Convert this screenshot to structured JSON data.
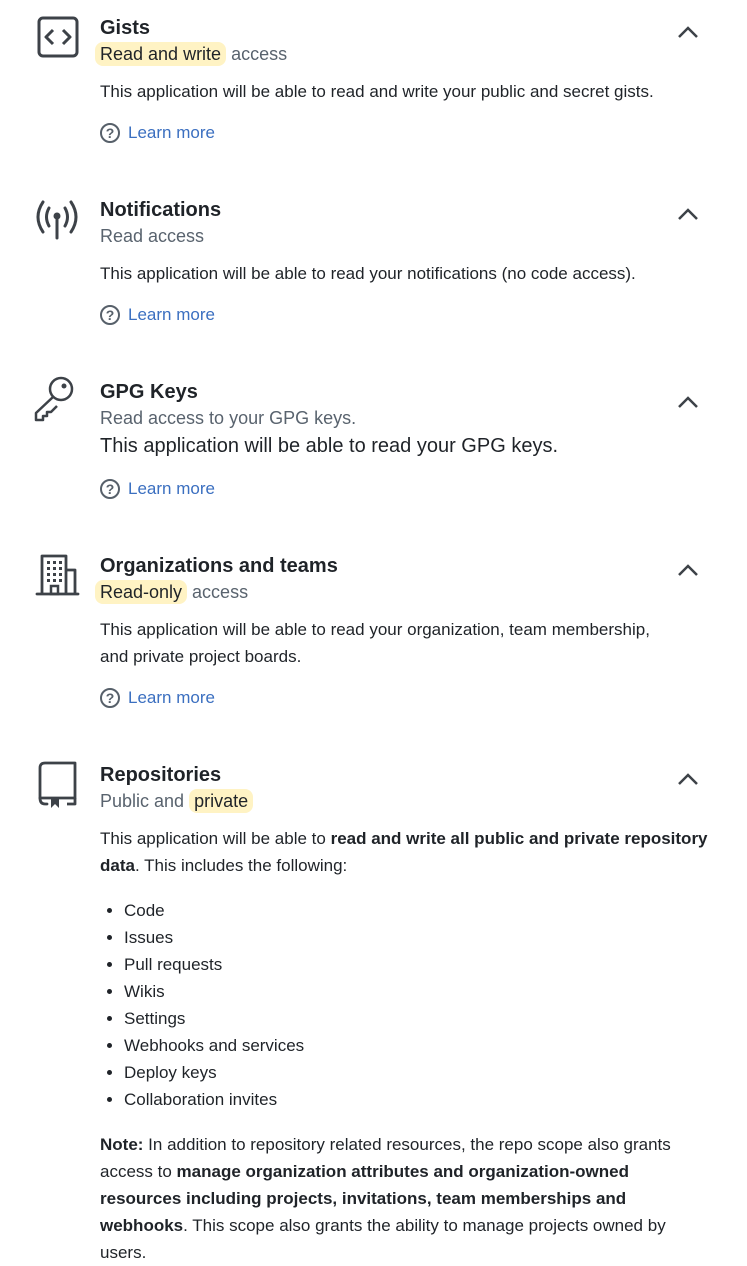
{
  "sections": {
    "gists": {
      "title": "Gists",
      "access_highlight": "Read and write",
      "access_rest": " access",
      "description": "This application will be able to read and write your public and secret gists.",
      "learn_more": "Learn more"
    },
    "notifications": {
      "title": "Notifications",
      "access": "Read access",
      "description": "This application will be able to read your notifications (no code access).",
      "learn_more": "Learn more"
    },
    "gpg": {
      "title": "GPG Keys",
      "access": "Read access to your GPG keys.",
      "description": "This application will be able to read your GPG keys.",
      "learn_more": "Learn more"
    },
    "orgs": {
      "title": "Organizations and teams",
      "access_highlight": "Read-only",
      "access_rest": " access",
      "description_line1": "This application will be able to read your organization, team membership,",
      "description_line2": "and private project boards.",
      "learn_more": "Learn more"
    },
    "repos": {
      "title": "Repositories",
      "access_prefix": "Public and ",
      "access_highlight": "private",
      "description_pre": "This application will be able to ",
      "description_bold": "read and write all public and private repository data",
      "description_post": ". This includes the following:",
      "items": [
        "Code",
        "Issues",
        "Pull requests",
        "Wikis",
        "Settings",
        "Webhooks and services",
        "Deploy keys",
        "Collaboration invites"
      ],
      "note_label": "Note:",
      "note_text1": " In addition to repository related resources, the repo scope also grants access to ",
      "note_bold": "manage organization attributes and organization-owned resources including projects, invitations, team memberships and webhooks",
      "note_text2": ". This scope also grants the ability to manage projects owned by users."
    }
  },
  "icons": {
    "gists": "code-square-icon",
    "notifications": "broadcast-icon",
    "gpg": "key-icon",
    "orgs": "organization-icon",
    "repos": "repo-icon",
    "help": "question-icon",
    "collapse": "chevron-up-icon"
  },
  "colors": {
    "highlight": "#fff3c4",
    "link": "#3b6fc0",
    "muted": "#59636e",
    "text": "#1f2328"
  }
}
